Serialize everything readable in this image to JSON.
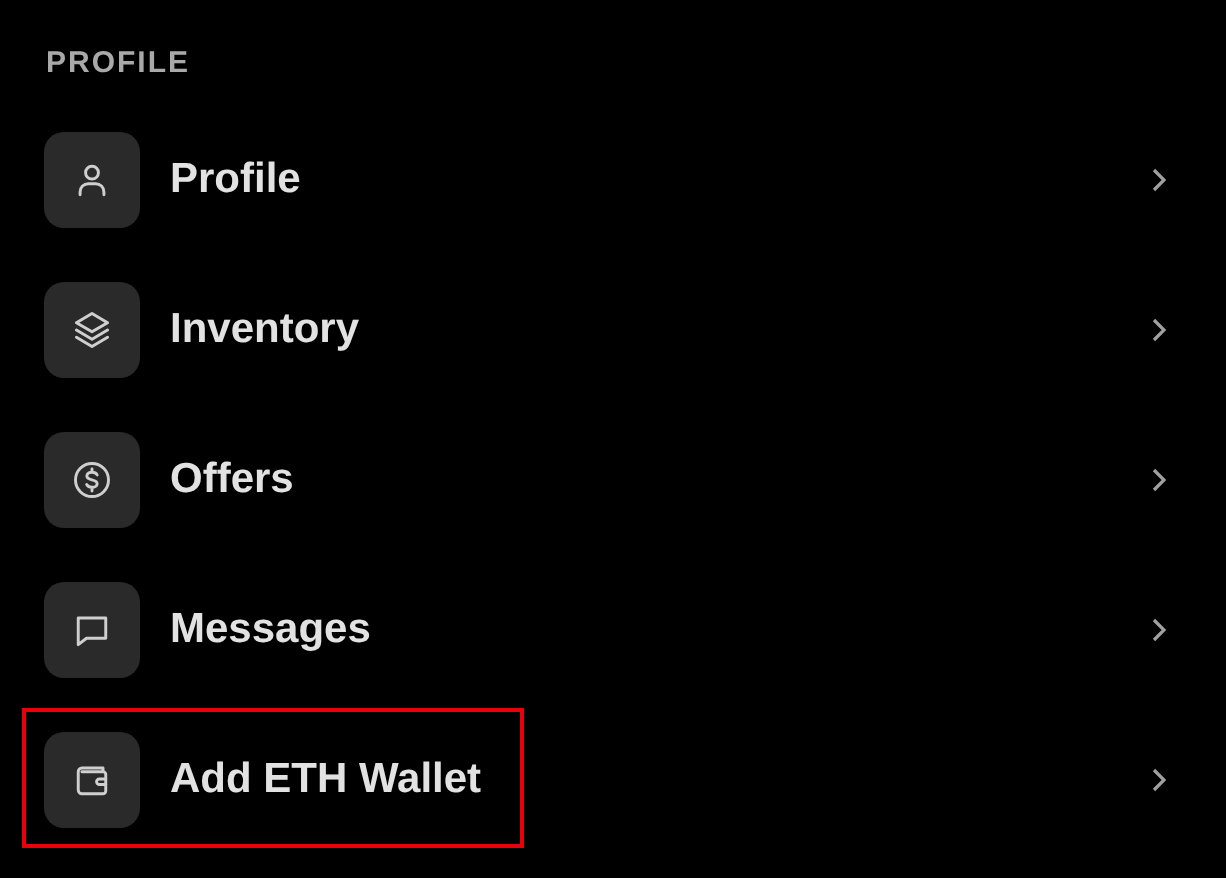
{
  "section_title": "PROFILE",
  "items": [
    {
      "label": "Profile",
      "highlighted": false
    },
    {
      "label": "Inventory",
      "highlighted": false
    },
    {
      "label": "Offers",
      "highlighted": false
    },
    {
      "label": "Messages",
      "highlighted": false
    },
    {
      "label": "Add ETH Wallet",
      "highlighted": true
    }
  ]
}
